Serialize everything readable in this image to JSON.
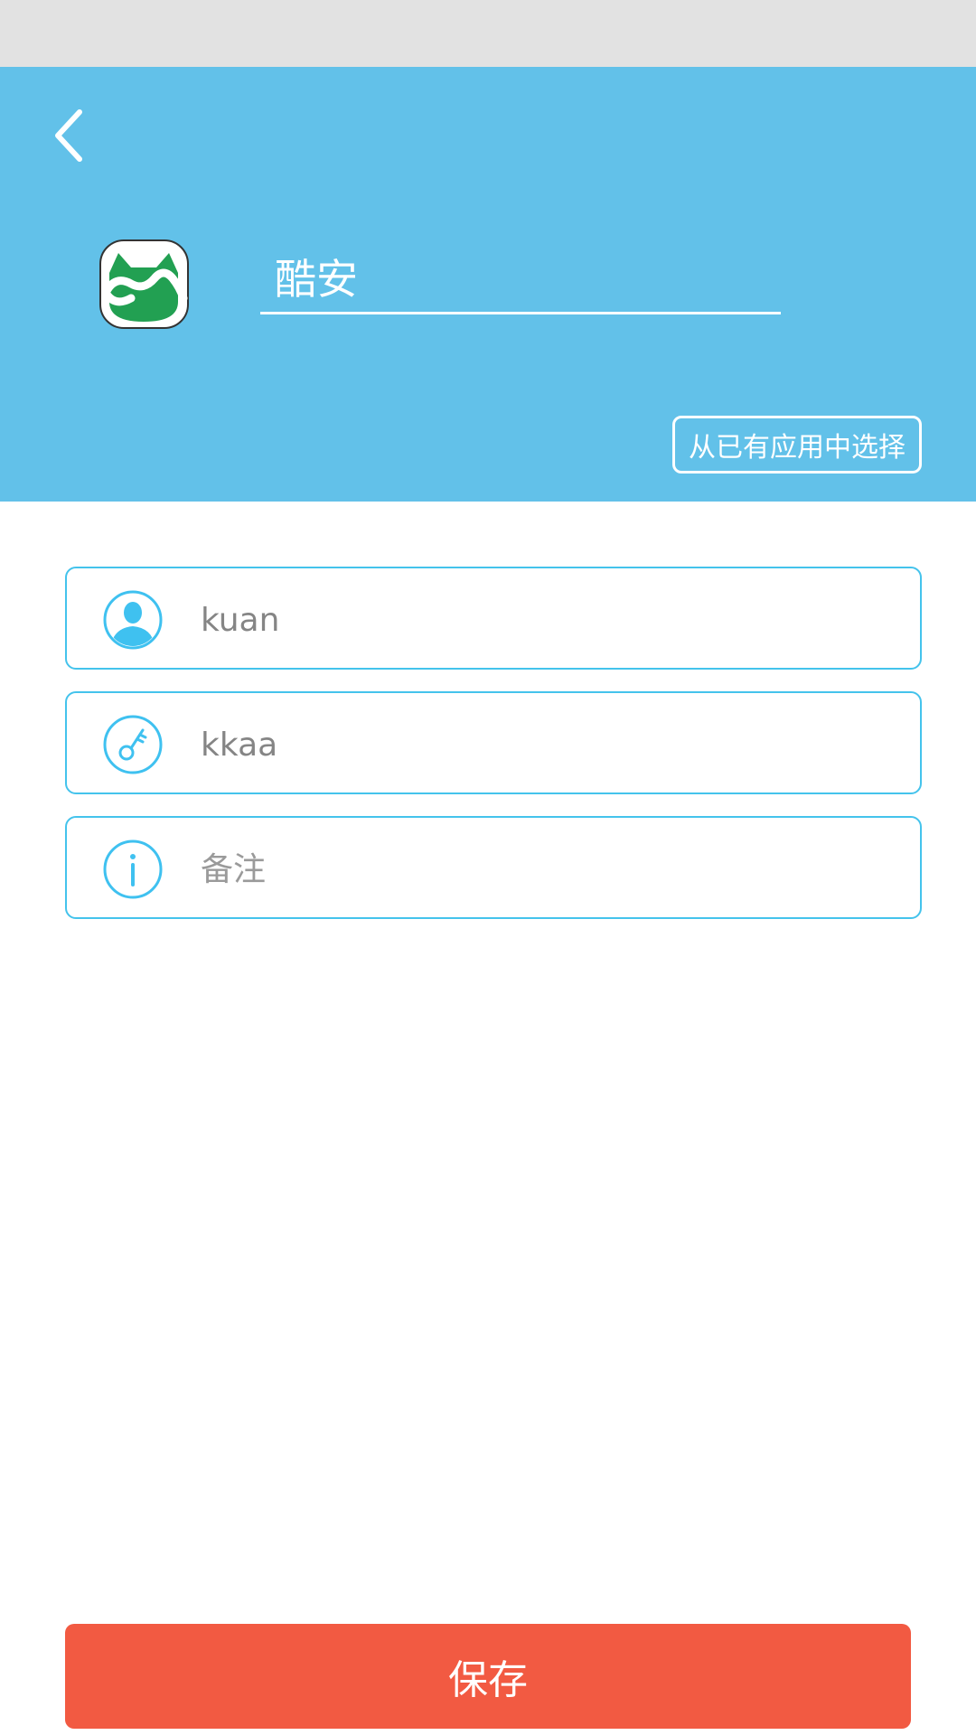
{
  "header": {
    "app_icon": "coolapk-logo",
    "back_icon": "chevron-left-icon",
    "app_name_value": "酷安",
    "choose_app_label": "从已有应用中选择",
    "background_color": "#62c1e9"
  },
  "form": {
    "username": {
      "icon": "user-icon",
      "value": "kuan"
    },
    "password": {
      "icon": "key-icon",
      "value": "kkaa"
    },
    "note": {
      "icon": "info-icon",
      "placeholder": "备注",
      "value": ""
    },
    "accent_color": "#44c3ec"
  },
  "footer": {
    "save_label": "保存",
    "save_color": "#f25a42"
  }
}
